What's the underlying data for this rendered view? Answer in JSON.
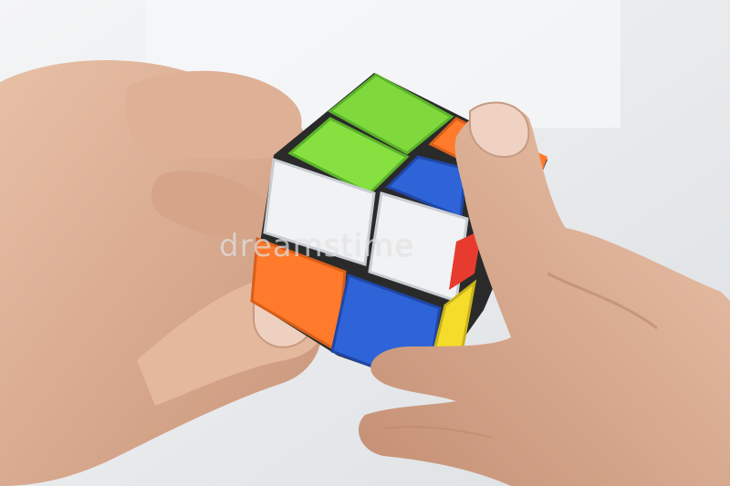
{
  "photo": {
    "subject": "hands-holding-cube",
    "watermark": "dreamstime",
    "colors": {
      "background": "#eef0f2",
      "skin": "#e3b79c",
      "skin_shadow": "#b98567",
      "cube_body": "#2a2a2a",
      "green": "#7fd93c",
      "white": "#f1f2f4",
      "blue": "#2f64d8",
      "orange": "#ff7a2a",
      "yellow": "#f5dc2a",
      "red": "#e63b2e"
    }
  }
}
